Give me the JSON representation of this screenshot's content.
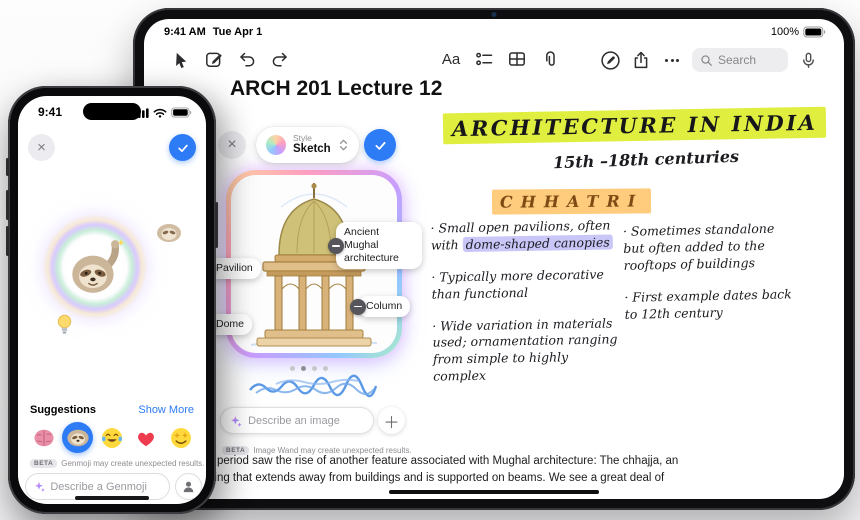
{
  "ipad": {
    "status": {
      "time": "9:41 AM",
      "date": "Tue Apr 1",
      "battery": "100%"
    },
    "toolbar": {
      "format_label": "Aa",
      "search_placeholder": "Search"
    },
    "note": {
      "title": "ARCH 201 Lecture 12",
      "body_line1": "s period saw the rise of another feature associated with Mughal architecture: The chhajja, an",
      "body_line2": "hing that extends away from buildings and is supported on beams. We see a great deal of"
    },
    "handwriting": {
      "heading": "ARCHITECTURE IN INDIA",
      "subheading": "15th –18th centuries",
      "section_title": "CHHATRI",
      "left_bullets": [
        {
          "prefix": "· Small open pavilions, often with ",
          "highlight": "dome-shaped canopies"
        },
        {
          "text": "· Typically more decorative than functional"
        },
        {
          "text": "· Wide variation in materials used; ornamentation ranging from simple to highly complex"
        }
      ],
      "right_bullets": [
        {
          "text": "· Sometimes standalone but often added to the rooftops of buildings"
        },
        {
          "text": "· First example dates back to 12th century"
        }
      ]
    },
    "image_wand": {
      "style_label": "Style",
      "style_value": "Sketch",
      "tags": [
        "Ancient Mughal architecture",
        "Pavilion",
        "Column",
        "Dome"
      ],
      "input_placeholder": "Describe an image",
      "beta_badge": "BETA",
      "beta_note": "Image Wand may create unexpected results."
    }
  },
  "iphone": {
    "status": {
      "time": "9:41"
    },
    "genmoji": {
      "suggestions_label": "Suggestions",
      "show_more_label": "Show More",
      "beta_badge": "BETA",
      "beta_note": "Genmoji may create unexpected results.",
      "input_placeholder": "Describe a Genmoji"
    }
  },
  "colors": {
    "accent_blue": "#2e7bf6",
    "highlight_yellow": "#e0ef3f",
    "highlight_orange": "#ffcb7d",
    "highlight_purple": "#c9c6f8"
  }
}
